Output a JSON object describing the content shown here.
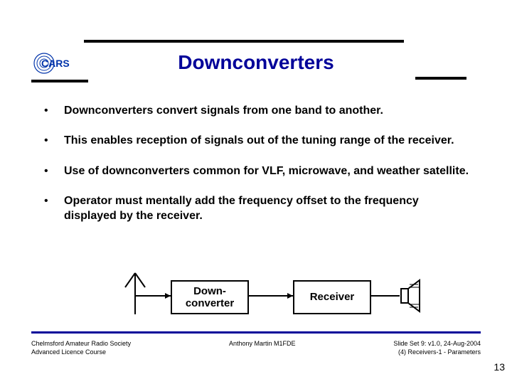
{
  "title": "Downconverters",
  "logo_text": "CARS",
  "bullets": [
    "Downconverters convert signals from one band to another.",
    "This enables reception of signals out of the tuning range of the receiver.",
    "Use of downconverters common for  VLF, microwave, and weather satellite.",
    "Operator must mentally add the frequency offset to the frequency displayed by the receiver."
  ],
  "diagram": {
    "downconverter": "Down-\nconverter",
    "receiver": "Receiver"
  },
  "footer": {
    "left_line1": "Chelmsford Amateur Radio Society",
    "left_line2": "Advanced Licence Course",
    "center": "Anthony Martin M1FDE",
    "right_line1": "Slide Set 9:  v1.0,  24-Aug-2004",
    "right_line2": "(4) Receivers-1 - Parameters"
  },
  "page_number": "13"
}
